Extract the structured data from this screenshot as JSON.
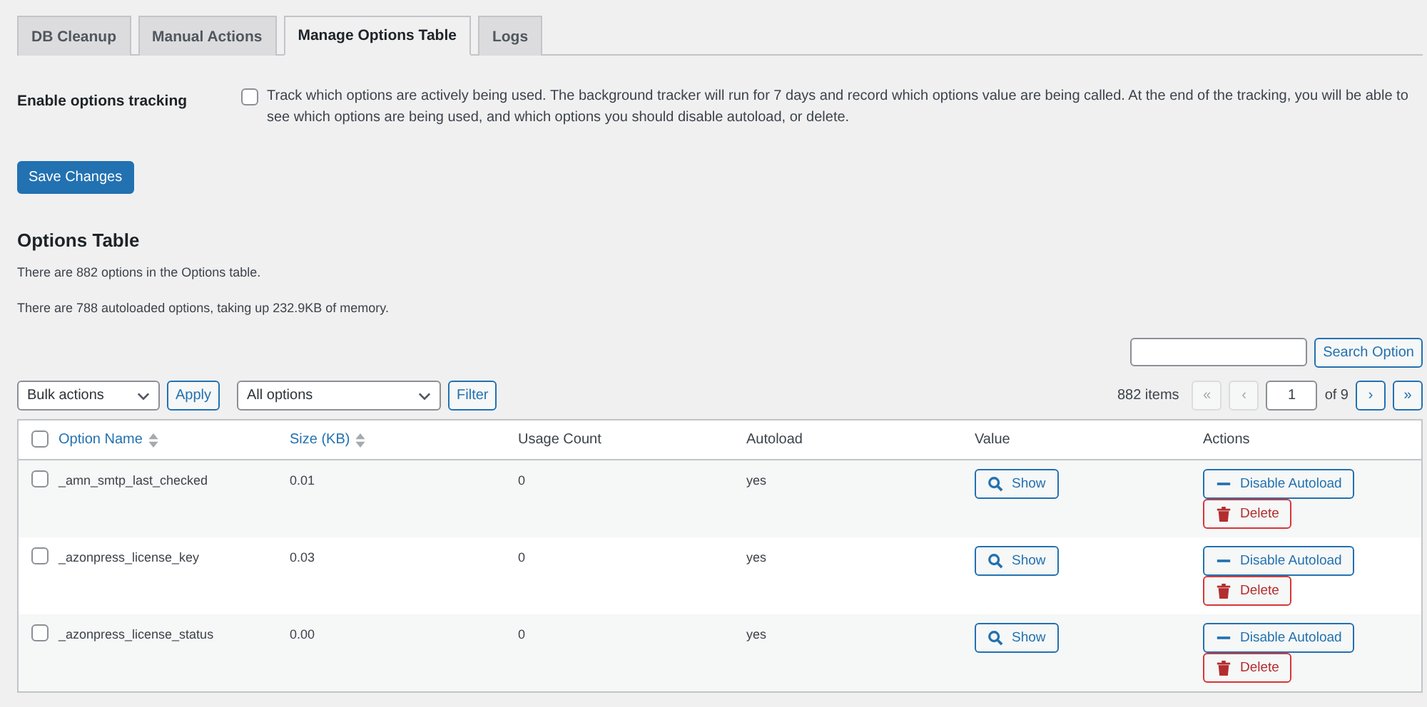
{
  "tabs": [
    {
      "label": "DB Cleanup",
      "selected": false
    },
    {
      "label": "Manual Actions",
      "selected": false
    },
    {
      "label": "Manage Options Table",
      "selected": true
    },
    {
      "label": "Logs",
      "selected": false
    }
  ],
  "tracking": {
    "label": "Enable options tracking",
    "checked": false,
    "description": "Track which options are actively being used. The background tracker will run for 7 days and record which options value are being called. At the end of the tracking, you will be able to see which options are being used, and which options you should disable autoload, or delete."
  },
  "save_button": "Save Changes",
  "section_title": "Options Table",
  "info": [
    "There are 882 options in the Options table.",
    "There are 788 autoloaded options, taking up 232.9KB of memory."
  ],
  "search": {
    "button": "Search Option"
  },
  "bulk": {
    "select": "Bulk actions",
    "apply": "Apply"
  },
  "filter": {
    "select": "All options",
    "button": "Filter"
  },
  "pagination": {
    "count": "882 items",
    "first": {
      "label": "«",
      "disabled": true
    },
    "prev": {
      "label": "‹",
      "disabled": true
    },
    "page": "1",
    "of": "of 9",
    "next": {
      "label": "›",
      "disabled": false
    },
    "last": {
      "label": "»",
      "disabled": false
    }
  },
  "table": {
    "select_all_checked": false,
    "columns": [
      {
        "label": "Option Name",
        "sortable": true
      },
      {
        "label": "Size (KB)",
        "sortable": true
      },
      {
        "label": "Usage Count",
        "sortable": false
      },
      {
        "label": "Autoload",
        "sortable": false
      },
      {
        "label": "Value",
        "sortable": false
      },
      {
        "label": "Actions",
        "sortable": false
      }
    ],
    "rows": [
      {
        "checked": false,
        "name": "_amn_smtp_last_checked",
        "size": "0.01",
        "usage": "0",
        "autoload": "yes",
        "show": "Show",
        "disable": "Disable Autoload",
        "delete": "Delete"
      },
      {
        "checked": false,
        "name": "_azonpress_license_key",
        "size": "0.03",
        "usage": "0",
        "autoload": "yes",
        "show": "Show",
        "disable": "Disable Autoload",
        "delete": "Delete"
      },
      {
        "checked": false,
        "name": "_azonpress_license_status",
        "size": "0.00",
        "usage": "0",
        "autoload": "yes",
        "show": "Show",
        "disable": "Disable Autoload",
        "delete": "Delete"
      }
    ]
  }
}
